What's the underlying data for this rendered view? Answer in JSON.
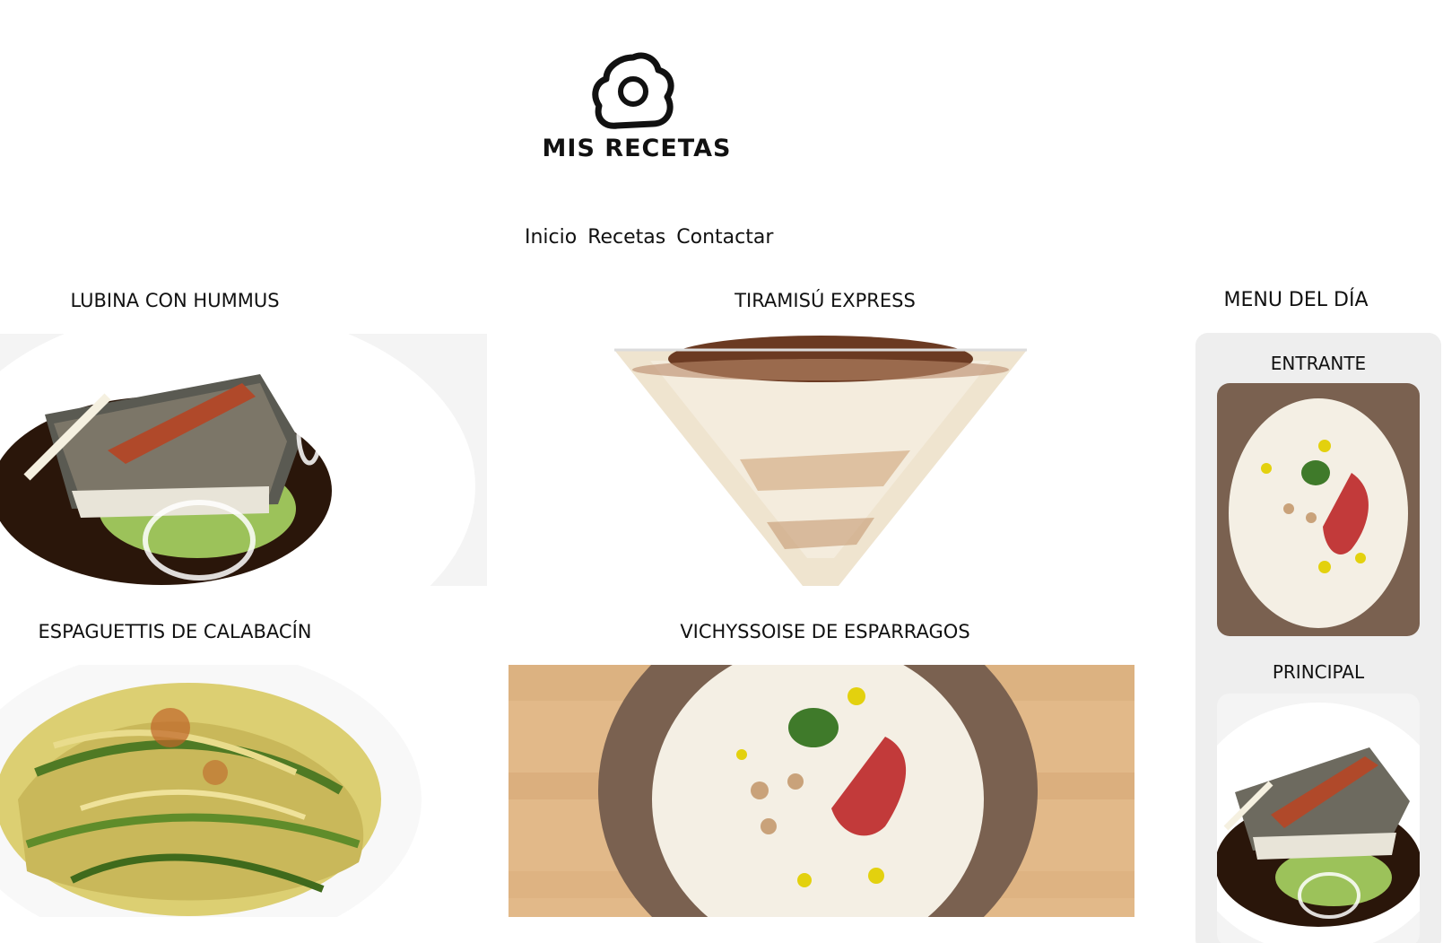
{
  "brand": {
    "name": "MIS RECETAS",
    "icon": "fried-egg-icon"
  },
  "nav": {
    "items": [
      {
        "label": "Inicio"
      },
      {
        "label": "Recetas"
      },
      {
        "label": "Contactar"
      }
    ]
  },
  "recipes": [
    {
      "title": "LUBINA CON HUMMUS",
      "image": "sea-bass-hummus-photo"
    },
    {
      "title": "TIRAMISÚ EXPRESS",
      "image": "tiramisu-glass-photo"
    },
    {
      "title": "ESPAGUETTIS DE CALABACÍN",
      "image": "zucchini-spaghetti-photo"
    },
    {
      "title": "VICHYSSOISE DE ESPARRAGOS",
      "image": "vichyssoise-bowl-photo"
    }
  ],
  "menu": {
    "title": "MENU DEL DÍA",
    "courses": [
      {
        "label": "ENTRANTE",
        "image": "vichyssoise-bowl-photo"
      },
      {
        "label": "PRINCIPAL",
        "image": "sea-bass-hummus-photo"
      }
    ]
  },
  "colors": {
    "background": "#ffffff",
    "sidebar": "#eeeeee",
    "text": "#111111"
  }
}
